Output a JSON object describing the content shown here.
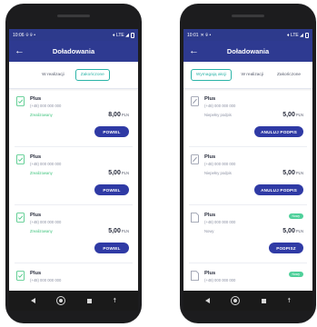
{
  "left": {
    "status": {
      "time": "10:06",
      "left_icons": "⌾ ⌾ •",
      "right_icons": "♦ LTE ◢"
    },
    "title": "Doładowania",
    "tabs": [
      {
        "label": "W realizacji",
        "active": false
      },
      {
        "label": "Zakończone",
        "active": true
      }
    ],
    "cards": [
      {
        "name": "Plus",
        "phone": "(+48) 000 000 000",
        "status": "Zrealizowany",
        "status_color": "#3fc47d",
        "amount": "8,00",
        "currency": "PLN",
        "button": "POWIEL"
      },
      {
        "name": "Plus",
        "phone": "(+48) 000 000 000",
        "status": "Zrealizowany",
        "status_color": "#3fc47d",
        "amount": "5,00",
        "currency": "PLN",
        "button": "POWIEL"
      },
      {
        "name": "Plus",
        "phone": "(+48) 000 000 000",
        "status": "Zrealizowany",
        "status_color": "#3fc47d",
        "amount": "5,00",
        "currency": "PLN",
        "button": "POWIEL"
      },
      {
        "name": "Plus",
        "phone": "(+48) 000 000 000"
      }
    ]
  },
  "right": {
    "status": {
      "time": "10:01",
      "left_icons": "✕ ⌾ •",
      "right_icons": "♦ LTE ◢"
    },
    "title": "Doładowania",
    "tabs": [
      {
        "label": "Wymagają akcji",
        "active": true
      },
      {
        "label": "W realizacji",
        "active": false
      },
      {
        "label": "Zakończone",
        "active": false
      }
    ],
    "cards": [
      {
        "icon": "edit-document-icon",
        "name": "Plus",
        "phone": "(+48) 000 000 000",
        "status": "Niepełny podpis",
        "amount": "5,00",
        "currency": "PLN",
        "button": "ANULUJ PODPIS"
      },
      {
        "icon": "edit-document-icon",
        "name": "Plus",
        "phone": "(+48) 000 000 000",
        "status": "Niepełny podpis",
        "amount": "5,00",
        "currency": "PLN",
        "button": "ANULUJ PODPIS"
      },
      {
        "icon": "document-icon",
        "name": "Plus",
        "phone": "(+48) 000 000 000",
        "status": "Nowy",
        "badge": "Nowy",
        "amount": "5,00",
        "currency": "PLN",
        "button": "PODPISZ"
      },
      {
        "icon": "document-icon",
        "name": "Plus",
        "phone": "(+48) 000 000 000",
        "badge": "Nowy"
      }
    ]
  },
  "colors": {
    "primary": "#2e3a91",
    "button": "#2f3aa5",
    "accent": "#2bb4a8",
    "success": "#3fc47d",
    "badge": "#4fd09a"
  }
}
